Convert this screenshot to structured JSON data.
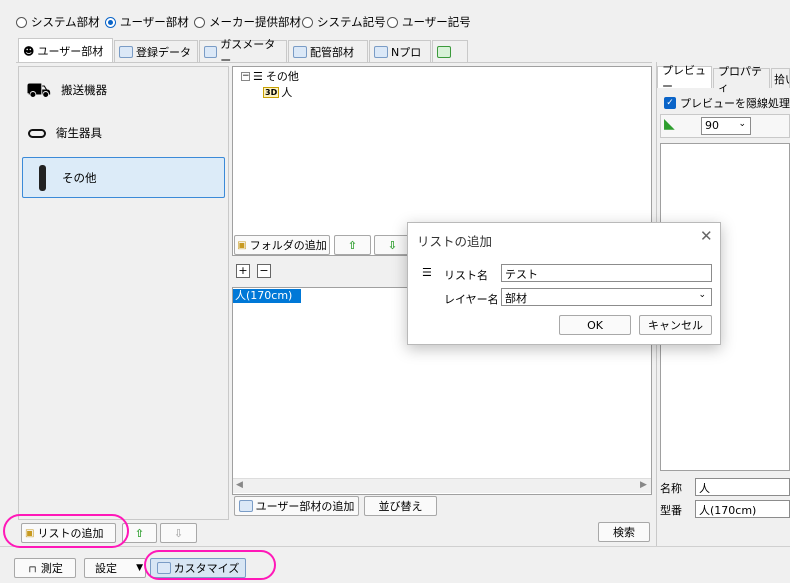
{
  "radio_options": [
    {
      "label": "システム部材",
      "selected": false
    },
    {
      "label": "ユーザー部材",
      "selected": true
    },
    {
      "label": "メーカー提供部材",
      "selected": false
    },
    {
      "label": "システム記号",
      "selected": false
    },
    {
      "label": "ユーザー記号",
      "selected": false
    }
  ],
  "tabs": [
    "ユーザー部材",
    "登録データ",
    "ガスメーター",
    "配管部材",
    "Nプロ",
    ""
  ],
  "categories": [
    "搬送機器",
    "衛生器具",
    "その他"
  ],
  "tree": {
    "root": "その他",
    "child": "人",
    "child_badge": "3D"
  },
  "mid_buttons": {
    "add_folder": "フォルダの追加"
  },
  "list": {
    "selected_item": "人(170cm)"
  },
  "bottom_buttons": {
    "add_user_part": "ユーザー部材の追加",
    "sort": "並び替え",
    "search": "検索",
    "add_list": "リストの追加"
  },
  "footer": {
    "measure": "測定",
    "settings": "設定",
    "customize": "カスタマイズ"
  },
  "right_panel": {
    "tabs": [
      "プレビュー",
      "プロパティ",
      "拾い"
    ],
    "checkbox_label": "プレビューを隠線処理す",
    "checkbox_checked": true,
    "zoom_value": "90",
    "name_label": "名称",
    "name_value": "人",
    "model_label": "型番",
    "model_value": "人(170cm)"
  },
  "dialog": {
    "title": "リストの追加",
    "list_name_label": "リスト名",
    "list_name_value": "テスト",
    "layer_label": "レイヤー名",
    "layer_value": "部材",
    "ok": "OK",
    "cancel": "キャンセル"
  },
  "colors": {
    "accent": "#0a64c8",
    "highlight": "#ff18b8",
    "selection": "#0078d7"
  }
}
